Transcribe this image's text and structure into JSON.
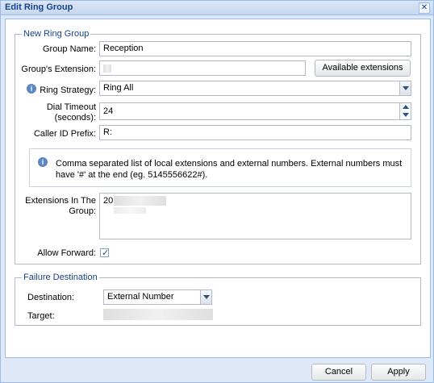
{
  "window": {
    "title": "Edit Ring Group",
    "close_glyph": "✕"
  },
  "ring_group": {
    "legend": "New Ring Group",
    "group_name": {
      "label": "Group Name:",
      "value": "Reception"
    },
    "extension": {
      "label": "Group's Extension:",
      "button": "Available extensions"
    },
    "strategy": {
      "label": "Ring Strategy:",
      "value": "Ring All"
    },
    "timeout": {
      "label_line1": "Dial Timeout",
      "label_line2": "(seconds):",
      "value": "24"
    },
    "caller_id": {
      "label": "Caller ID Prefix:",
      "value": "R:"
    },
    "note": "Comma separated list of local extensions and external numbers. External numbers must have '#' at the end (eg. 5145556622#).",
    "extensions": {
      "label_line1": "Extensions In The",
      "label_line2": "Group:",
      "value": "20"
    },
    "allow_forward": {
      "label": "Allow Forward:",
      "checked": true
    }
  },
  "failure": {
    "legend": "Failure Destination",
    "destination": {
      "label": "Destination:",
      "value": "External Number"
    },
    "target": {
      "label": "Target:"
    }
  },
  "footer": {
    "cancel": "Cancel",
    "apply": "Apply"
  },
  "icons": [
    "info-icon",
    "close-icon",
    "chevron-down-icon",
    "spinner-up-icon",
    "spinner-down-icon",
    "checkmark-icon"
  ]
}
